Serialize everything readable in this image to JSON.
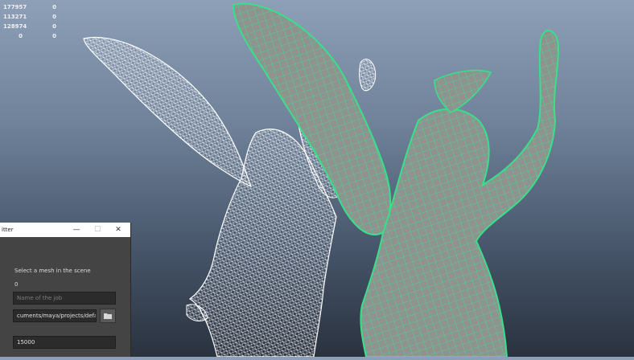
{
  "stats": {
    "rows": [
      {
        "a": "177957",
        "b": "0"
      },
      {
        "a": "113271",
        "b": "0"
      },
      {
        "a": "128974",
        "b": "0"
      },
      {
        "a": "0",
        "b": "0"
      }
    ]
  },
  "viewport": {
    "background_top": "#8e9fb8",
    "background_bottom": "#2a323e",
    "wireframe_color": "#ffffff",
    "retopo_color": "#39e08a",
    "shaded_color": "#8f9490"
  },
  "panel": {
    "title": "itter",
    "minimize_label": "—",
    "maximize_label": "☐",
    "close_label": "✕",
    "instruction": "Select a mesh in the scene",
    "count": "0",
    "job_placeholder": "Name of the job",
    "path_value": "cuments/maya/projects/default/",
    "number_value": "15000",
    "folder_icon": "folder-icon"
  }
}
